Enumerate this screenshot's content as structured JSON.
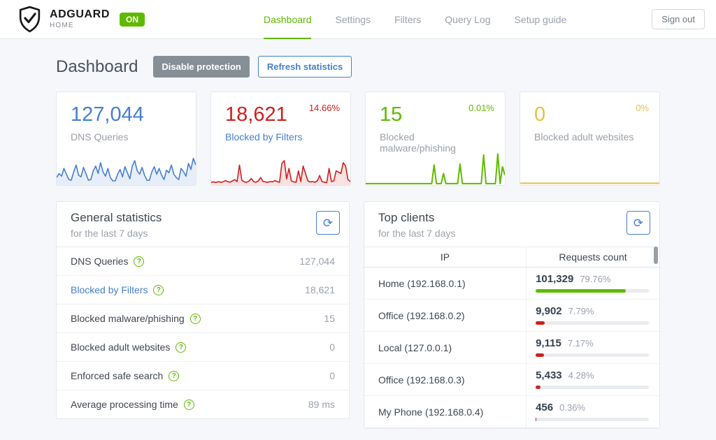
{
  "header": {
    "brand": {
      "title": "ADGUARD",
      "subtitle": "HOME",
      "status_badge": "ON"
    },
    "nav": {
      "items": [
        {
          "label": "Dashboard",
          "active": true
        },
        {
          "label": "Settings",
          "active": false
        },
        {
          "label": "Filters",
          "active": false
        },
        {
          "label": "Query Log",
          "active": false
        },
        {
          "label": "Setup guide",
          "active": false
        }
      ]
    },
    "signout_label": "Sign out"
  },
  "page": {
    "title": "Dashboard",
    "disable_button": "Disable protection",
    "refresh_button": "Refresh statistics"
  },
  "colors": {
    "blue": "#467fcf",
    "red": "#cd201f",
    "green": "#5eba00",
    "yellow": "#e9c046",
    "muted": "#9aa0ac"
  },
  "cards": [
    {
      "value": "127,044",
      "label": "DNS Queries",
      "percent": "",
      "color": "#467fcf",
      "label_link": false,
      "fill": true,
      "stroke": 1.6,
      "spark": [
        18,
        30,
        22,
        45,
        28,
        12,
        10,
        35,
        55,
        25,
        20,
        48,
        30,
        10,
        12,
        38,
        52,
        30,
        62,
        35,
        22,
        45,
        18,
        8,
        8,
        28,
        42,
        20,
        50,
        32,
        14,
        52,
        68,
        38,
        28,
        48,
        25,
        10,
        10,
        35,
        50,
        28,
        45,
        25,
        12,
        40,
        32,
        55,
        28,
        18,
        12,
        45,
        35,
        22,
        60,
        42,
        75,
        55
      ]
    },
    {
      "value": "18,621",
      "label": "Blocked by Filters",
      "percent": "14.66%",
      "color": "#cd201f",
      "label_link": true,
      "fill": true,
      "stroke": 1.6,
      "spark": [
        4,
        5,
        3,
        6,
        4,
        5,
        9,
        6,
        4,
        8,
        12,
        6,
        55,
        10,
        5,
        4,
        7,
        15,
        6,
        4,
        8,
        18,
        6,
        5,
        4,
        6,
        5,
        9,
        6,
        4,
        60,
        68,
        14,
        45,
        8,
        5,
        4,
        38,
        6,
        52,
        30,
        8,
        5,
        6,
        4,
        8,
        24,
        6,
        4,
        3,
        45,
        6,
        8,
        38,
        34,
        30,
        62,
        52,
        12,
        6
      ]
    },
    {
      "value": "15",
      "label": "Blocked malware/phishing",
      "percent": "0.01%",
      "color": "#5eba00",
      "label_link": false,
      "fill": false,
      "stroke": 2,
      "spark": [
        0,
        0,
        0,
        0,
        0,
        0,
        0,
        0,
        0,
        0,
        0,
        0,
        0,
        0,
        0,
        0,
        0,
        0,
        0,
        0,
        0,
        0,
        0,
        0,
        0,
        0,
        0,
        0,
        0,
        55,
        0,
        0,
        0,
        30,
        0,
        0,
        0,
        0,
        0,
        0,
        58,
        0,
        0,
        0,
        0,
        0,
        0,
        0,
        0,
        0,
        85,
        0,
        0,
        0,
        0,
        0,
        88,
        0,
        50,
        25
      ]
    },
    {
      "value": "0",
      "label": "Blocked adult websites",
      "percent": "0%",
      "color": "#e9c046",
      "label_link": false,
      "fill": false,
      "stroke": 2,
      "spark": [
        1,
        1
      ]
    }
  ],
  "general_stats": {
    "title": "General statistics",
    "subtitle": "for the last 7 days",
    "refresh_icon": "⟳",
    "rows": [
      {
        "label": "DNS Queries",
        "value": "127,044",
        "link": false
      },
      {
        "label": "Blocked by Filters",
        "value": "18,621",
        "link": true
      },
      {
        "label": "Blocked malware/phishing",
        "value": "15",
        "link": false
      },
      {
        "label": "Blocked adult websites",
        "value": "0",
        "link": false
      },
      {
        "label": "Enforced safe search",
        "value": "0",
        "link": false
      },
      {
        "label": "Average processing time",
        "value": "89 ms",
        "link": false
      }
    ]
  },
  "top_clients": {
    "title": "Top clients",
    "subtitle": "for the last 7 days",
    "refresh_icon": "⟳",
    "columns": [
      "IP",
      "Requests count"
    ],
    "rows": [
      {
        "name": "Home",
        "ip": "(192.168.0.1)",
        "count": "101,329",
        "percent": "79.76%",
        "bar": 79.76,
        "bar_color": "#5eba00"
      },
      {
        "name": "Office",
        "ip": "(192.168.0.2)",
        "count": "9,902",
        "percent": "7.79%",
        "bar": 7.79,
        "bar_color": "#cd201f"
      },
      {
        "name": "Local",
        "ip": "(127.0.0.1)",
        "count": "9,115",
        "percent": "7.17%",
        "bar": 7.17,
        "bar_color": "#cd201f"
      },
      {
        "name": "Office",
        "ip": "(192.168.0.3)",
        "count": "5,433",
        "percent": "4.28%",
        "bar": 4.28,
        "bar_color": "#cd201f"
      },
      {
        "name": "My Phone",
        "ip": "(192.168.0.4)",
        "count": "456",
        "percent": "0.36%",
        "bar": 0.36,
        "bar_color": "#cd201f"
      }
    ]
  }
}
